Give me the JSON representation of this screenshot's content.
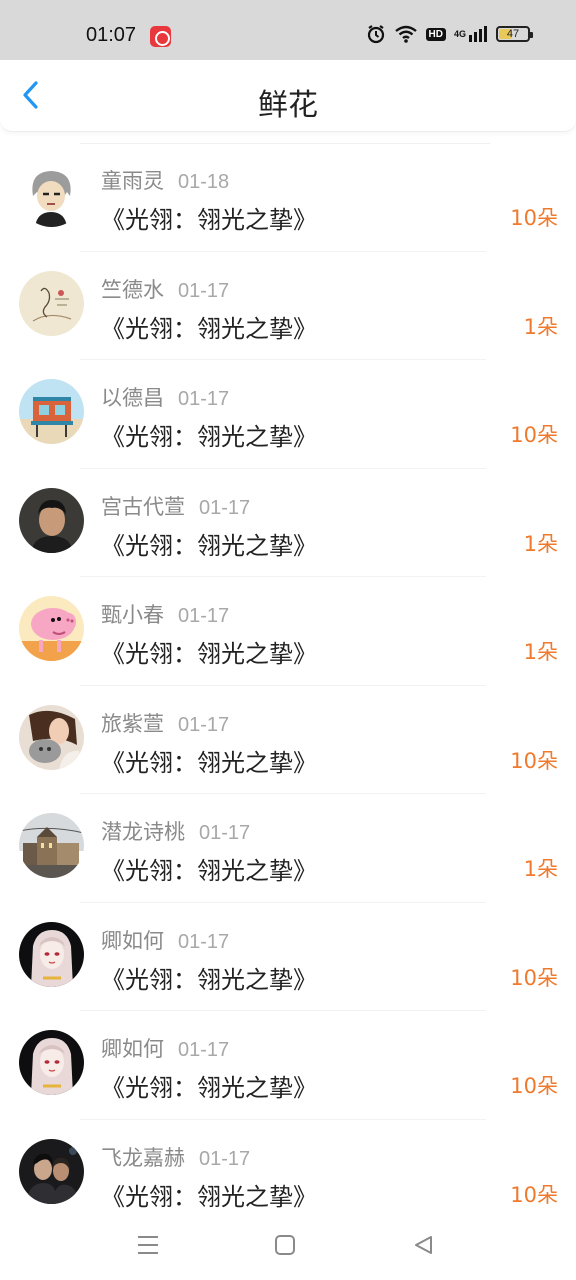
{
  "status_bar": {
    "time": "01:07",
    "battery": "47",
    "network": "4G",
    "hd_label": "HD",
    "icons": [
      "app-notification-icon",
      "alarm-icon",
      "wifi-icon",
      "hd-icon",
      "signal-4g-icon",
      "battery-icon"
    ]
  },
  "header": {
    "title": "鲜花",
    "back_icon": "chevron-left-icon",
    "accent_color": "#2196f3"
  },
  "items": [
    {
      "user": "童雨灵",
      "date": "01-18",
      "book": "《光翎：翎光之挚》",
      "count": "10朵",
      "avatar": "cartoon-boy"
    },
    {
      "user": "竺德水",
      "date": "01-17",
      "book": "《光翎：翎光之挚》",
      "count": "1朵",
      "avatar": "sketch-art"
    },
    {
      "user": "以德昌",
      "date": "01-17",
      "book": "《光翎：翎光之挚》",
      "count": "10朵",
      "avatar": "lifeguard-tower"
    },
    {
      "user": "宫古代萱",
      "date": "01-17",
      "book": "《光翎：翎光之挚》",
      "count": "1朵",
      "avatar": "young-man"
    },
    {
      "user": "甄小春",
      "date": "01-17",
      "book": "《光翎：翎光之挚》",
      "count": "1朵",
      "avatar": "pink-pig"
    },
    {
      "user": "旅紫萱",
      "date": "01-17",
      "book": "《光翎：翎光之挚》",
      "count": "10朵",
      "avatar": "girl-with-cat"
    },
    {
      "user": "潜龙诗桃",
      "date": "01-17",
      "book": "《光翎：翎光之挚》",
      "count": "1朵",
      "avatar": "city-buildings"
    },
    {
      "user": "卿如何",
      "date": "01-17",
      "book": "《光翎：翎光之挚》",
      "count": "10朵",
      "avatar": "anime-girl"
    },
    {
      "user": "卿如何",
      "date": "01-17",
      "book": "《光翎：翎光之挚》",
      "count": "10朵",
      "avatar": "anime-girl"
    },
    {
      "user": "飞龙嘉赫",
      "date": "01-17",
      "book": "《光翎：翎光之挚》",
      "count": "10朵",
      "avatar": "couple-night"
    }
  ],
  "nav_bar": {
    "icons": [
      "menu-icon",
      "home-square-icon",
      "back-triangle-icon"
    ]
  },
  "colors": {
    "count": "#ef7a2d",
    "username": "#8a8a8a",
    "status_bar_bg": "#d9d9d9"
  }
}
